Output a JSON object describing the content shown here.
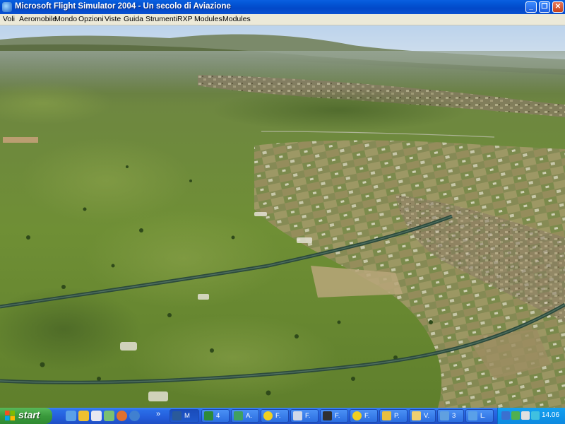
{
  "window": {
    "title": "Microsoft Flight Simulator 2004 - Un secolo di Aviazione",
    "minimize_glyph": "_",
    "maximize_glyph": "❐",
    "close_glyph": "✕"
  },
  "menu": {
    "items": [
      "Voli",
      "Aeromobile",
      "Mondo",
      "Opzioni",
      "Viste",
      "Guida",
      "Strumenti",
      "RXP",
      "Modules",
      "Modules"
    ]
  },
  "taskbar": {
    "start_label": "start",
    "quick_launch_icons": [
      "ie-icon",
      "outlook-icon",
      "media-player-icon",
      "messenger-icon",
      "firefox-icon",
      "search-icon"
    ],
    "overflow_glyph": "»",
    "tasks": [
      {
        "label": "M",
        "icon": "flightsim-icon",
        "active": true
      },
      {
        "label": "4",
        "icon": "excel-icon",
        "active": false
      },
      {
        "label": "A.",
        "icon": "tool-icon",
        "active": false
      },
      {
        "label": "F.",
        "icon": "yellow-circle-icon",
        "active": false
      },
      {
        "label": "F.",
        "icon": "plane-icon",
        "active": false
      },
      {
        "label": "F.",
        "icon": "monitor-icon",
        "active": false
      },
      {
        "label": "F.",
        "icon": "yellow-circle-icon",
        "active": false
      },
      {
        "label": "P.",
        "icon": "paint-icon",
        "active": false
      },
      {
        "label": "V.",
        "icon": "folder-icon",
        "active": false
      },
      {
        "label": "3",
        "icon": "group-icon",
        "active": false
      },
      {
        "label": "L.",
        "icon": "ie-icon",
        "active": false
      }
    ],
    "clock": "14.06"
  },
  "colors": {
    "titlebar": "#0458d8",
    "menubar": "#ece9d8",
    "start_button": "#3a9a3c",
    "sky": "#c9dcef",
    "terrain": "#6b8a3a"
  }
}
